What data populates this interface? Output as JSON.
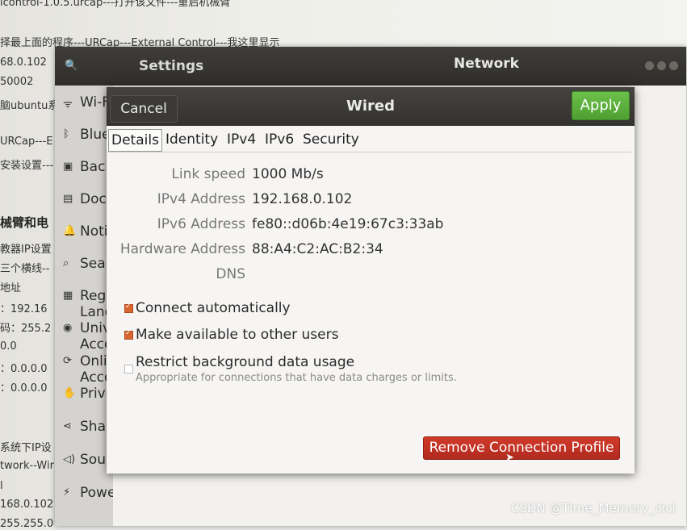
{
  "background_doc": {
    "lines": [
      {
        "text": "lcontrol-1.0.5.urcap---打开该文件---重启机械臂",
        "bold": false
      },
      {
        "text": "择最上面的程序---URCap---External Control---我这里显示",
        "bold": false
      },
      {
        "text": "68.0.102",
        "bold": false
      },
      {
        "text": "50002",
        "bold": false
      },
      {
        "text": "脑ubuntu系",
        "bold": false
      },
      {
        "text": "URCap---E",
        "bold": false
      },
      {
        "text": "安装设置---",
        "bold": false
      },
      {
        "text": "械臂和电",
        "bold": true
      },
      {
        "text": "教器IP设置",
        "bold": false
      },
      {
        "text": "三个横线--",
        "bold": false
      },
      {
        "text": "地址",
        "bold": false
      },
      {
        "text": "：192.16",
        "bold": false
      },
      {
        "text": "码：255.2",
        "bold": false
      },
      {
        "text": "0.0",
        "bold": false
      },
      {
        "text": "：0.0.0.0",
        "bold": false
      },
      {
        "text": "：0.0.0.0",
        "bold": false
      },
      {
        "text": "系统下IP设",
        "bold": false
      },
      {
        "text": "twork--Wir",
        "bold": false
      },
      {
        "text": "l",
        "bold": false
      },
      {
        "text": "168.0.102",
        "bold": false
      },
      {
        "text": "255.255.0",
        "bold": false
      }
    ]
  },
  "watermark": "CSDN @Time_Memory_cici",
  "settings": {
    "title": "Settings",
    "panel_title": "Network",
    "sidebar": [
      {
        "icon": "wifi-icon",
        "glyph": "ᯤ",
        "label": "Wi-Fi"
      },
      {
        "icon": "bluetooth-icon",
        "glyph": "ᛒ",
        "label": "Bluetooth"
      },
      {
        "icon": "background-icon",
        "glyph": "▣",
        "label": "Background"
      },
      {
        "icon": "dock-icon",
        "glyph": "▤",
        "label": "Dock"
      },
      {
        "icon": "notifications-icon",
        "glyph": "🔔",
        "label": "Notifications"
      },
      {
        "icon": "search-icon",
        "glyph": "⌕",
        "label": "Search"
      },
      {
        "icon": "region-icon",
        "glyph": "▦",
        "label": "Region & Language"
      },
      {
        "icon": "universal-access-icon",
        "glyph": "◉",
        "label": "Universal Access"
      },
      {
        "icon": "online-accounts-icon",
        "glyph": "⟳",
        "label": "Online Accounts"
      },
      {
        "icon": "privacy-icon",
        "glyph": "✋",
        "label": "Privacy"
      },
      {
        "icon": "sharing-icon",
        "glyph": "⋖",
        "label": "Sharing"
      },
      {
        "icon": "sound-icon",
        "glyph": "◁)",
        "label": "Sound"
      },
      {
        "icon": "power-icon",
        "glyph": "⚡",
        "label": "Power"
      }
    ]
  },
  "dialog": {
    "title": "Wired",
    "cancel_label": "Cancel",
    "apply_label": "Apply",
    "tabs": [
      "Details",
      "Identity",
      "IPv4",
      "IPv6",
      "Security"
    ],
    "active_tab": "Details",
    "fields": [
      {
        "label": "Link speed",
        "value": "1000 Mb/s"
      },
      {
        "label": "IPv4 Address",
        "value": "192.168.0.102"
      },
      {
        "label": "IPv6 Address",
        "value": "fe80::d06b:4e19:67c3:33ab"
      },
      {
        "label": "Hardware Address",
        "value": "88:A4:C2:AC:B2:34"
      },
      {
        "label": "DNS",
        "value": ""
      }
    ],
    "checkboxes": [
      {
        "label": "Connect automatically",
        "checked": true
      },
      {
        "label": "Make available to other users",
        "checked": true
      },
      {
        "label": "Restrict background data usage",
        "sublabel": "Appropriate for connections that have data charges or limits.",
        "checked": false
      }
    ],
    "remove_label": "Remove Connection Profile"
  },
  "colors": {
    "apply_green": "#5cb23d",
    "remove_red": "#c33224",
    "checkbox_orange": "#d8652f",
    "header_dark": "#3a3935"
  }
}
